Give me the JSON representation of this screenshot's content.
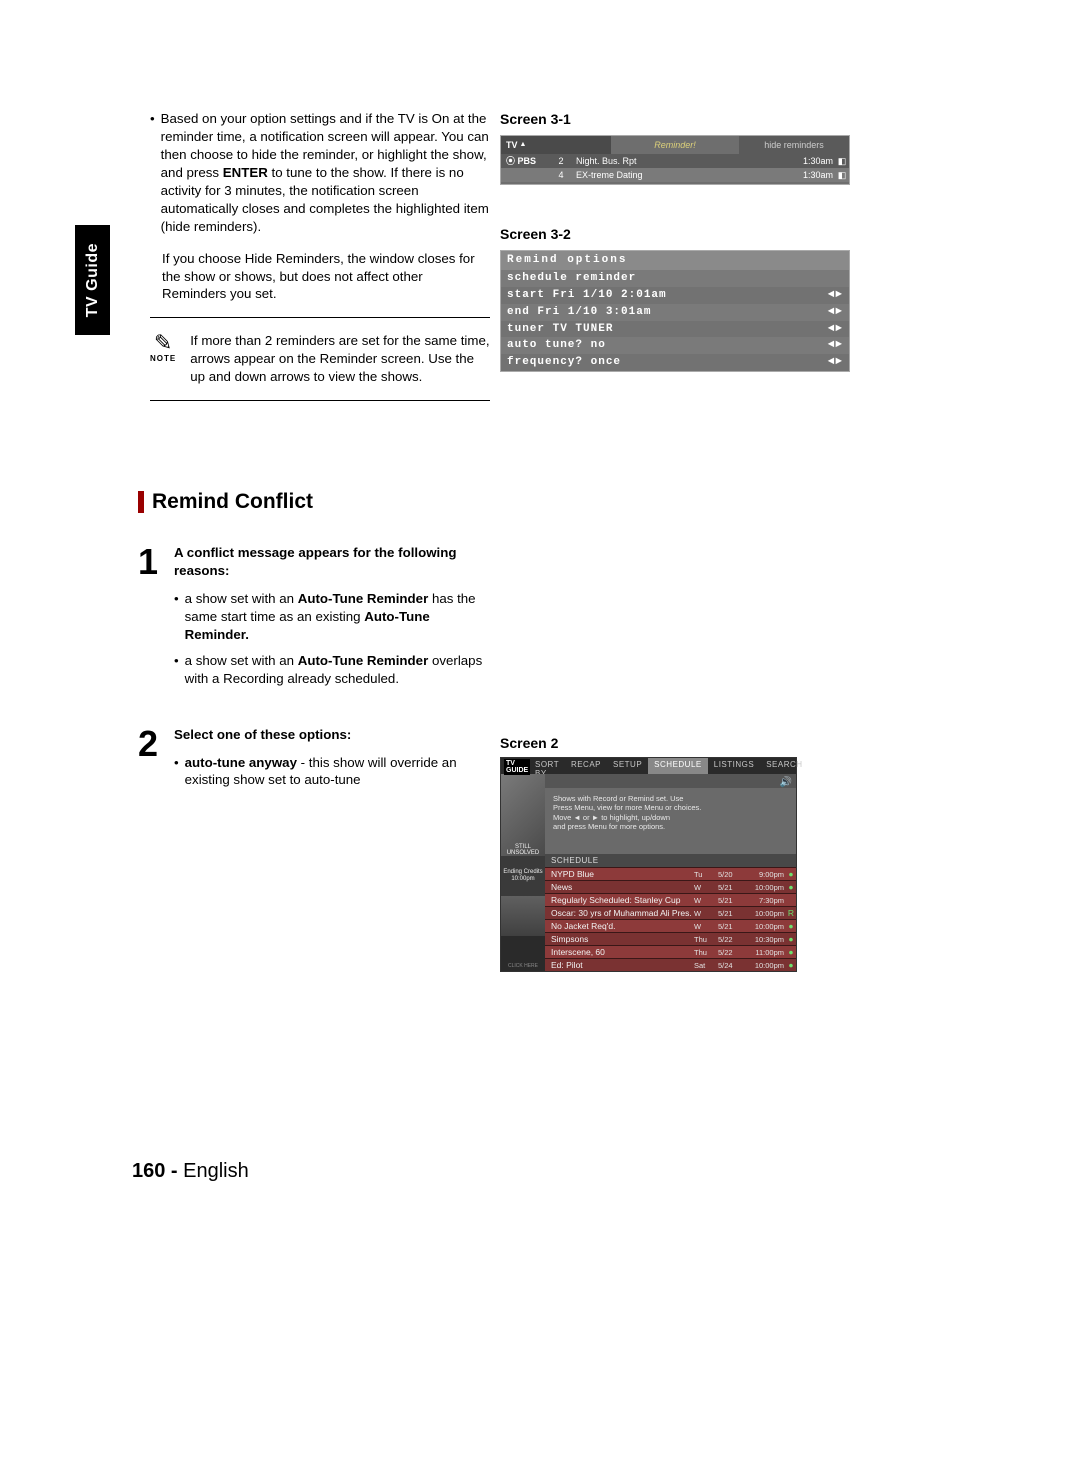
{
  "sideTab": "TV Guide",
  "leftTop": {
    "p1_pre": "Based on your option settings and if the TV is On at the reminder time, a notification screen will appear. You can then choose to hide the reminder, or highlight the show, and press ",
    "p1_bold": "ENTER",
    "p1_post": " to tune to the show. If there is no activity for 3 minutes, the notification screen automatically closes and completes the highlighted item (hide reminders).",
    "p2": "If you choose Hide Reminders, the window closes for the show or shows, but does not affect other Reminders you set."
  },
  "note": {
    "label": "NOTE",
    "text": "If more than 2 reminders are set for the same time, arrows appear on the Reminder screen. Use the up and down arrows to view the shows."
  },
  "remind": {
    "title": "Remind Conflict",
    "step1": {
      "num": "1",
      "lead": "A conflict message appears for the following reasons:",
      "b1_pre": "a show set with an ",
      "b1_b1": "Auto-Tune Reminder",
      "b1_mid": " has the same start time as an existing ",
      "b1_b2": "Auto-Tune Reminder.",
      "b2_pre": "a show set with an ",
      "b2_b1": "Auto-Tune Reminder",
      "b2_post": " overlaps with a Recording already scheduled."
    },
    "step2": {
      "num": "2",
      "lead": "Select one of these options:",
      "b1_b": "auto-tune anyway",
      "b1_post": " - this show will override an existing show set to auto-tune"
    }
  },
  "screenLabels": {
    "s31": "Screen 3-1",
    "s32": "Screen 3-2",
    "s2": "Screen 2"
  },
  "screen31": {
    "logo": "TV",
    "headerCenter": "Reminder!",
    "headerRight": "hide reminders",
    "rows": [
      {
        "channel": "⦿ PBS",
        "num": "2",
        "title": "Night. Bus. Rpt",
        "time": "1:30am"
      },
      {
        "channel": "",
        "num": "4",
        "title": "EX-treme Dating",
        "time": "1:30am"
      }
    ]
  },
  "screen32": {
    "title": "Remind options",
    "rows": [
      {
        "l": "schedule reminder",
        "r": ""
      },
      {
        "l": "start Fri  1/10  2:01am",
        "r": "◄►"
      },
      {
        "l": "end   Fri  1/10  3:01am",
        "r": "◄►"
      },
      {
        "l": "tuner  TV TUNER",
        "r": "◄►"
      },
      {
        "l": "auto tune?   no",
        "r": "◄►"
      },
      {
        "l": "frequency?  once",
        "r": "◄►"
      }
    ]
  },
  "screen2": {
    "tabs": [
      "SORT BY",
      "RECAP",
      "SETUP",
      "SCHEDULE",
      "LISTINGS",
      "SEARCH"
    ],
    "activeTab": 3,
    "promo": "STILL UNSOLVED",
    "promo2a": "Ending Credits",
    "promo2b": "10:00pm",
    "promo4": "CLICK HERE",
    "infoLines": [
      "Shows with Record or Remind set. Use",
      "Press Menu, view for more Menu or choices.",
      "Move ◄ or ► to highlight, up/down",
      "and press Menu for more options."
    ],
    "category": "SCHEDULE",
    "rows": [
      {
        "title": "NYPD Blue",
        "day": "Tu",
        "date": "5/20",
        "time": "9:00pm",
        "ind": "●"
      },
      {
        "title": "News",
        "day": "W",
        "date": "5/21",
        "time": "10:00pm",
        "ind": "●"
      },
      {
        "title": "Regularly Scheduled: Stanley Cup",
        "day": "W",
        "date": "5/21",
        "time": "7:30pm",
        "ind": ""
      },
      {
        "title": "Oscar: 30 yrs of Muhammad Ali Pres.",
        "day": "W",
        "date": "5/21",
        "time": "10:00pm",
        "ind": "R"
      },
      {
        "title": "No Jacket Req'd.",
        "day": "W",
        "date": "5/21",
        "time": "10:00pm",
        "ind": "●"
      },
      {
        "title": "Simpsons",
        "day": "Thu",
        "date": "5/22",
        "time": "10:30pm",
        "ind": "●"
      },
      {
        "title": "Interscene, 60",
        "day": "Thu",
        "date": "5/22",
        "time": "11:00pm",
        "ind": "●"
      },
      {
        "title": "Ed: Pilot",
        "day": "Sat",
        "date": "5/24",
        "time": "10:00pm",
        "ind": "●"
      }
    ]
  },
  "pageNumber": {
    "num": "160 -",
    "lang": "English"
  }
}
